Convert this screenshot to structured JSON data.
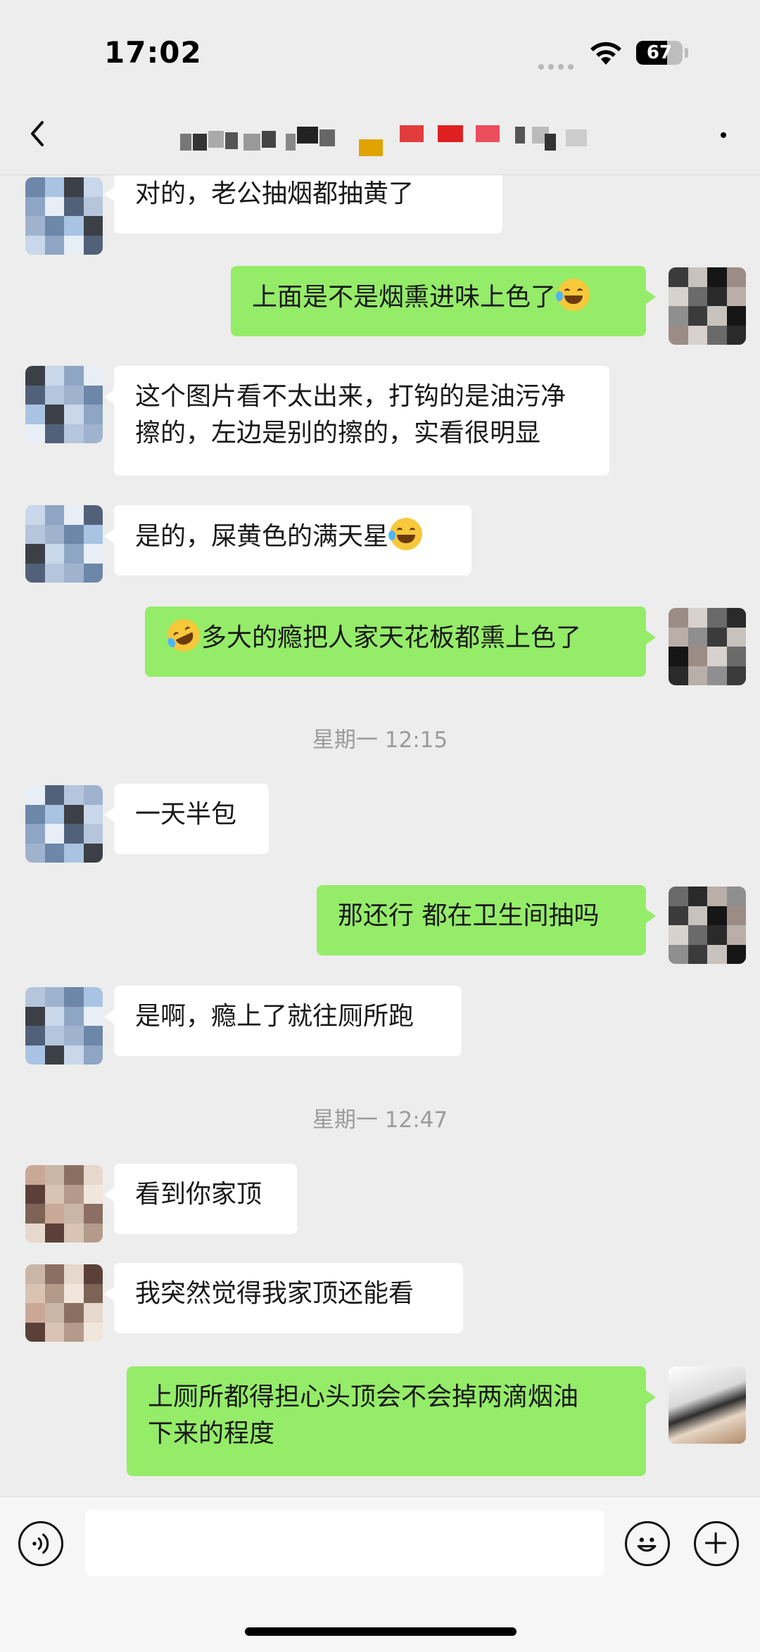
{
  "status_bar": {
    "time": "17:02",
    "battery_level": "67",
    "battery_fraction": 0.67
  },
  "nav": {
    "back_icon": "chevron-left-icon",
    "title_obscured": true,
    "more_icon": "more-dot-icon"
  },
  "messages": [
    {
      "side": "in",
      "text": "对的，老公抽烟都抽黄了"
    },
    {
      "side": "out",
      "text": "上面是不是烟熏进味上色了",
      "emoji_after": "joy-emoji"
    },
    {
      "side": "in",
      "text": "这个图片看不太出来，打钩的是油污净\n擦的，左边是别的擦的，实看很明显"
    },
    {
      "side": "in",
      "text": "是的，屎黄色的满天星",
      "emoji_after": "joy-emoji"
    },
    {
      "side": "out",
      "text": "多大的瘾把人家天花板都熏上色了",
      "emoji_before": "rofl-emoji"
    },
    {
      "side": "in",
      "text": "一天半包"
    },
    {
      "side": "out",
      "text": "那还行 都在卫生间抽吗"
    },
    {
      "side": "in",
      "text": "是啊，瘾上了就往厕所跑"
    },
    {
      "side": "in",
      "text": "看到你家顶"
    },
    {
      "side": "in",
      "text": "我突然觉得我家顶还能看"
    },
    {
      "side": "out",
      "text": "上厕所都得担心头顶会不会掉两滴烟油\n下来的程度"
    }
  ],
  "timestamps": [
    {
      "text": "星期一 12:15"
    },
    {
      "text": "星期一 12:47"
    }
  ],
  "input_bar": {
    "voice_icon": "voice-icon",
    "emoji_icon": "emoji-icon",
    "plus_icon": "plus-icon",
    "input_value": ""
  },
  "colors": {
    "background": "#ededed",
    "bubble_out": "#95ec69",
    "bubble_in": "#ffffff",
    "timestamp": "#9b9b9b"
  }
}
